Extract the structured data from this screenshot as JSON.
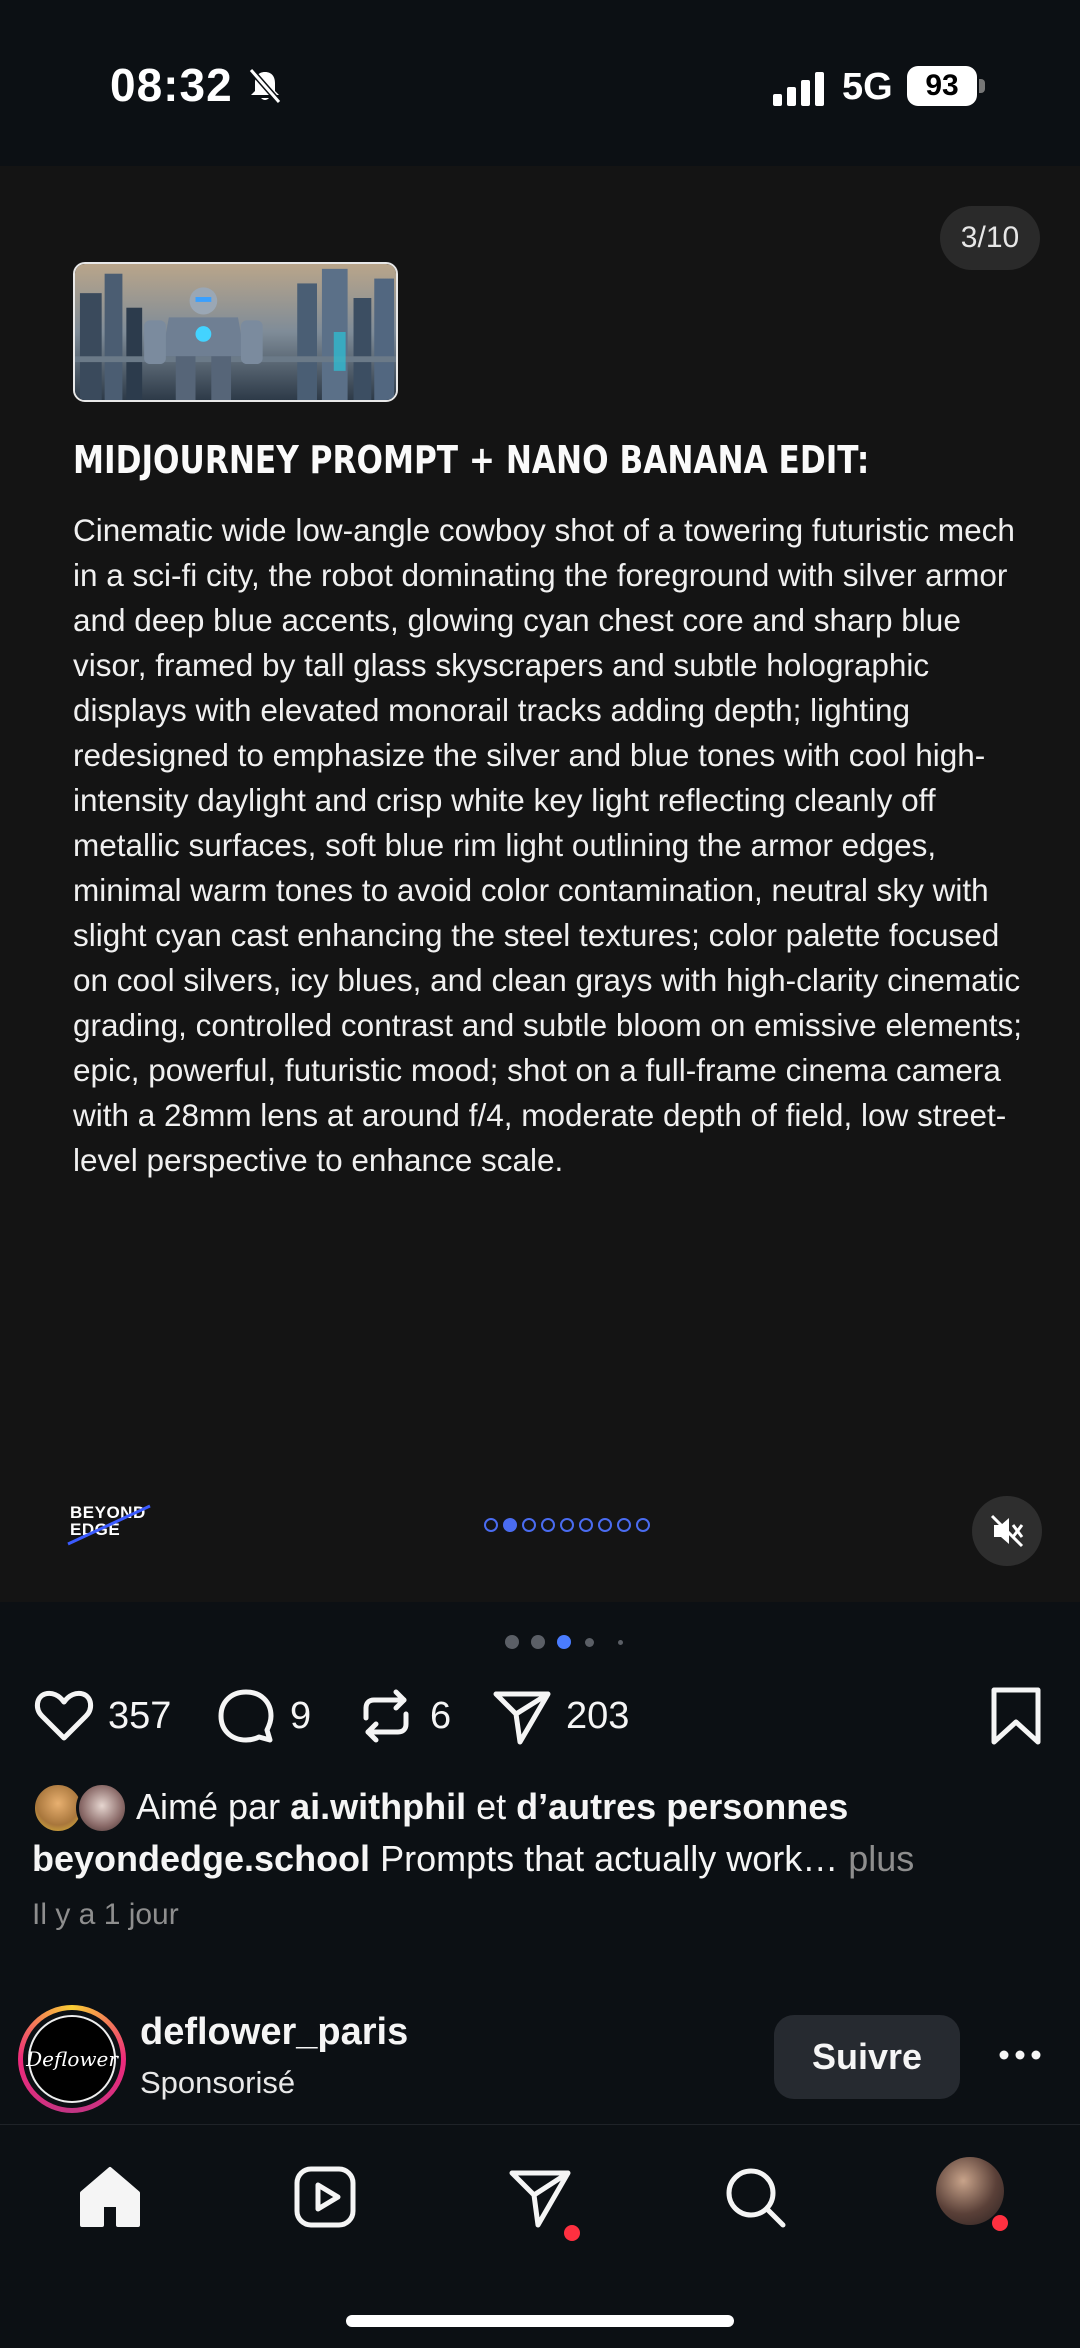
{
  "status_bar": {
    "time": "08:32",
    "network": "5G",
    "battery": "93"
  },
  "post": {
    "slide_counter": "3/10",
    "slide": {
      "title": "MIDJOURNEY PROMPT + NANO BANANA EDIT:",
      "body": "Cinematic wide low-angle cowboy shot of a towering futuristic mech in a sci-fi city, the robot dominating the foreground with silver armor and deep blue accents, glowing cyan chest core and sharp blue visor, framed by tall glass skyscrapers and subtle holographic displays with elevated monorail tracks adding depth; lighting redesigned to emphasize the silver and blue tones with cool high-intensity daylight and crisp white key light reflecting cleanly off metallic surfaces, soft blue rim light outlining the armor edges, minimal warm tones to avoid color contamination, neutral sky with slight cyan cast enhancing the steel textures; color palette focused on cool silvers, icy blues, and clean grays with high-clarity cinematic grading, controlled contrast and subtle bloom on emissive elements; epic, powerful, futuristic mood; shot on a full-frame cinema camera with a 28mm lens at around f/4, moderate depth of field, low street-level perspective to enhance scale.",
      "brand_logo": "BEYOND EDGE",
      "inner_dots_total": 9,
      "inner_dots_active": 1
    },
    "actions": {
      "likes": "357",
      "comments": "9",
      "reposts": "6",
      "shares": "203"
    },
    "liked_by": {
      "prefix": "Aimé par",
      "user": "ai.withphil",
      "joiner": "et",
      "others": "d’autres personnes"
    },
    "caption": {
      "username": "beyondedge.school",
      "text": "Prompts that actually work…",
      "more": "plus"
    },
    "timestamp": "Il y a 1 jour"
  },
  "next_post": {
    "username": "deflower_paris",
    "subtitle": "Sponsorisé",
    "follow_label": "Suivre",
    "avatar_text": "Deflower"
  },
  "tab_bar": {
    "items": [
      "home-icon",
      "reels-icon",
      "direct-icon",
      "search-icon",
      "profile-avatar"
    ]
  },
  "colors": {
    "background": "#0c1014",
    "slide_background": "#141414",
    "accent_dot": "#4a6cf0",
    "badge": "#ff3040"
  }
}
